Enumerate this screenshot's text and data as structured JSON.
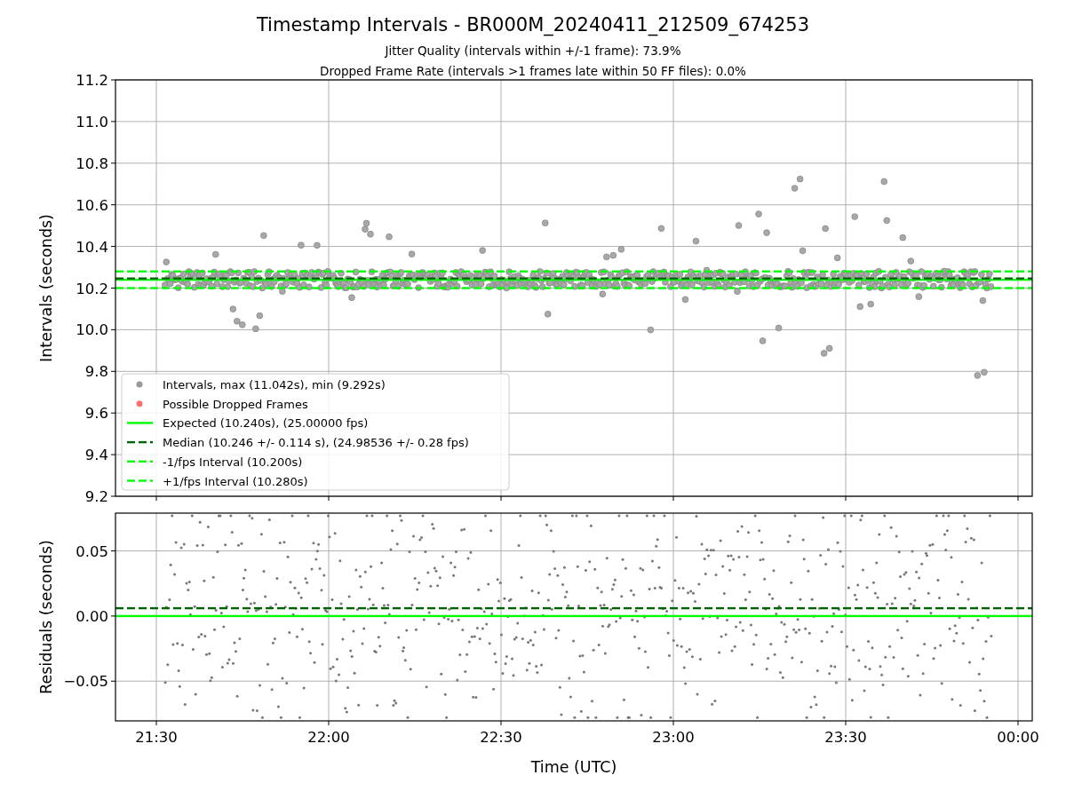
{
  "figure": {
    "title": "Timestamp Intervals - BR000M_20240411_212509_674253",
    "subtitles": [
      "Jitter Quality (intervals within +/-1 frame): 73.9%",
      "Dropped Frame Rate (intervals >1 frames late within 50 FF files): 0.0%"
    ]
  },
  "intervals_panel": {
    "ylabel": "Intervals (seconds)",
    "yticks": [
      "11.2",
      "11.0",
      "10.8",
      "10.6",
      "10.4",
      "10.2",
      "10.0",
      "9.8",
      "9.6",
      "9.4",
      "9.2"
    ],
    "legend": [
      {
        "label": "Intervals, max (11.042s), min (9.292s)",
        "kind": "marker",
        "color": "#999999"
      },
      {
        "label": "Possible Dropped Frames",
        "kind": "marker",
        "color": "#ff7070"
      },
      {
        "label": "Expected (10.240s), (25.00000 fps)",
        "kind": "solid",
        "color": "#00ff00"
      },
      {
        "label": "Median (10.246 +/- 0.114 s), (24.98536 +/- 0.28 fps)",
        "kind": "dashed",
        "color": "#006400"
      },
      {
        "label": "-1/fps Interval (10.200s)",
        "kind": "dashed",
        "color": "#00ff00"
      },
      {
        "label": "+1/fps Interval (10.280s)",
        "kind": "dashed",
        "color": "#00ff00"
      }
    ]
  },
  "residuals_panel": {
    "ylabel": "Residuals (seconds)",
    "xlabel": "Time (UTC)",
    "xticks": [
      "21:30",
      "22:00",
      "22:30",
      "23:00",
      "23:30",
      "00:00"
    ],
    "yticks": [
      "0.05",
      "0.00",
      "−0.05"
    ]
  }
}
